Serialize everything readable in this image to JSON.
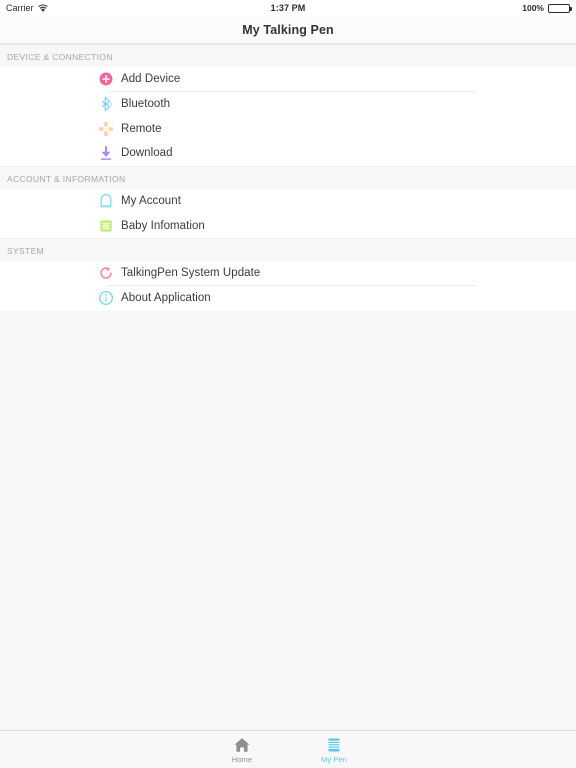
{
  "statusbar": {
    "carrier": "Carrier",
    "wifi_icon": "wifi-icon",
    "time": "1:37 PM",
    "battery_percent": "100%",
    "battery_icon": "battery-full-icon"
  },
  "navbar": {
    "title": "My Talking Pen"
  },
  "sections": [
    {
      "header": "DEVICE & CONNECTION",
      "rows": [
        {
          "label": "Add Device",
          "icon": "add-circle-icon",
          "color": "#f4639b"
        },
        {
          "label": "Bluetooth",
          "icon": "bluetooth-icon",
          "color": "#7fd4f5"
        },
        {
          "label": "Remote",
          "icon": "remote-dpad-icon",
          "color": "#fcd1a0"
        },
        {
          "label": "Download",
          "icon": "download-arrow-icon",
          "color": "#a98bea"
        }
      ]
    },
    {
      "header": "ACCOUNT & INFORMATION",
      "rows": [
        {
          "label": "My Account",
          "icon": "account-person-icon",
          "color": "#8fe0f5"
        },
        {
          "label": "Baby Infomation",
          "icon": "list-document-icon",
          "color": "#c2f07a"
        }
      ]
    },
    {
      "header": "SYSTEM",
      "rows": [
        {
          "label": "TalkingPen System Update",
          "icon": "refresh-update-icon",
          "color": "#f58a96"
        },
        {
          "label": "About Application",
          "icon": "info-circle-icon",
          "color": "#7fd4f5"
        }
      ]
    }
  ],
  "tabbar": {
    "tabs": [
      {
        "label": "Home",
        "icon": "home-icon",
        "active": false
      },
      {
        "label": "My Pen",
        "icon": "mypen-book-icon",
        "active": true
      }
    ]
  },
  "colors": {
    "accent": "#5ac8e8",
    "table_bg": "#f7f7f7",
    "row_bg": "#ffffff",
    "separator": "#ededef",
    "header_text": "#a6a6ab",
    "label_text": "#3b3b3d"
  }
}
